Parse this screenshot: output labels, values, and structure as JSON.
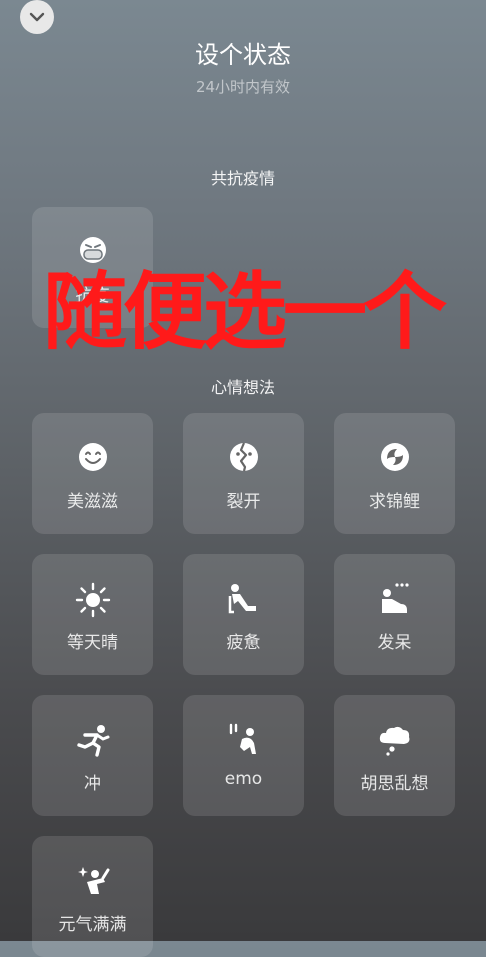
{
  "header": {
    "title": "设个状态",
    "subtitle": "24小时内有效",
    "collapse_icon": "chevron-down-icon"
  },
  "sections": [
    {
      "title": "共抗疫情",
      "items": [
        {
          "label": "抗疫",
          "icon": "masked-face-icon"
        }
      ]
    },
    {
      "title": "心情想法",
      "items": [
        {
          "label": "美滋滋",
          "icon": "smile-face-icon"
        },
        {
          "label": "裂开",
          "icon": "cracked-face-icon"
        },
        {
          "label": "求锦鲤",
          "icon": "koi-fish-icon"
        },
        {
          "label": "等天晴",
          "icon": "sun-icon"
        },
        {
          "label": "疲惫",
          "icon": "tired-person-icon"
        },
        {
          "label": "发呆",
          "icon": "daze-person-icon"
        },
        {
          "label": "冲",
          "icon": "running-person-icon"
        },
        {
          "label": "emo",
          "icon": "emo-person-icon"
        },
        {
          "label": "胡思乱想",
          "icon": "thought-cloud-icon"
        },
        {
          "label": "元气满满",
          "icon": "energetic-person-icon"
        }
      ]
    }
  ],
  "overlay_text": "随便选一个",
  "colors": {
    "overlay": "#ff1a1a",
    "tile_bg": "rgba(255,255,255,0.12)",
    "icon": "#ffffff"
  }
}
